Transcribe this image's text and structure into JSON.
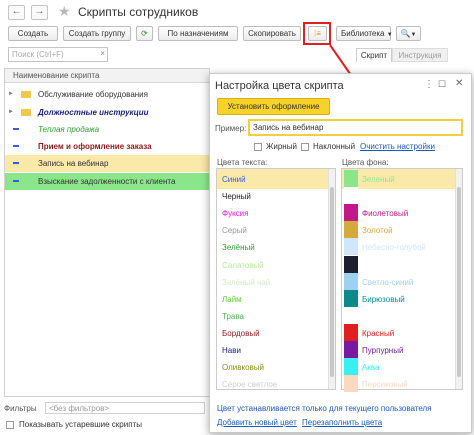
{
  "window": {
    "title": "Скрипты сотрудников"
  },
  "toolbar": {
    "create": "Создать",
    "create_group": "Создать группу",
    "by_assignments": "По назначениям",
    "copy": "Скопировать",
    "library": "Библиотека"
  },
  "search": {
    "placeholder": "Поиск (Ctrl+F)"
  },
  "table": {
    "header": "Наименование скрипта",
    "rows": [
      {
        "label": "Обслуживание оборудования"
      },
      {
        "label": "Должностные инструкции"
      },
      {
        "label": "Теплая продажа"
      },
      {
        "label": "Прием и оформление заказа"
      },
      {
        "label": "Запись на вебинар"
      },
      {
        "label": "Взыскание задолженности с клиента"
      }
    ]
  },
  "right_tabs": {
    "script": "Скрипт",
    "instruction": "Инструкция"
  },
  "footer": {
    "filters_label": "Фильтры",
    "filters_value": "<без фильтров>",
    "show_old": "Показывать устаревшие скрипты"
  },
  "dialog": {
    "title": "Настройка цвета скрипта",
    "apply_button": "Установить оформление",
    "example_label": "Пример:",
    "example_value": "Запись на вебинар",
    "bold_label": "Жирный",
    "italic_label": "Наклонный",
    "clear_link": "Очистить настройки",
    "text_colors_label": "Цвета текста:",
    "bg_colors_label": "Цвета фона:",
    "text_colors": [
      {
        "name": "Синий",
        "color": "#3b5bd8"
      },
      {
        "name": "Черный",
        "color": "#222222"
      },
      {
        "name": "Фуксия",
        "color": "#e020e0"
      },
      {
        "name": "Серый",
        "color": "#999999"
      },
      {
        "name": "Зелёный",
        "color": "#2f9e2f"
      },
      {
        "name": "Салатовый",
        "color": "#b4e89a"
      },
      {
        "name": "Зелёный чай",
        "color": "#d3ecc6"
      },
      {
        "name": "Лайм",
        "color": "#66cc33"
      },
      {
        "name": "Трава",
        "color": "#52b452"
      },
      {
        "name": "Бордовый",
        "color": "#8b1a1a"
      },
      {
        "name": "Нави",
        "color": "#1a237e"
      },
      {
        "name": "Оливковый",
        "color": "#8a8a1a"
      },
      {
        "name": "Серое светлое",
        "color": "#cfcfcf"
      }
    ],
    "bg_colors": [
      {
        "name": "Зеленый",
        "color": "#8be68b"
      },
      {
        "name": "",
        "color": "#ffffff"
      },
      {
        "name": "Фиолетовый",
        "color": "#c2188a"
      },
      {
        "name": "Золотой",
        "color": "#d4aa3c"
      },
      {
        "name": "Небесно-голубой",
        "color": "#cfe6fb"
      },
      {
        "name": "",
        "color": "#1f1f2f"
      },
      {
        "name": "Светло-синий",
        "color": "#9fd0f0"
      },
      {
        "name": "Бирюзовый",
        "color": "#0a8a8a"
      },
      {
        "name": "",
        "color": "#ffffff"
      },
      {
        "name": "Красный",
        "color": "#e02020"
      },
      {
        "name": "Пурпурный",
        "color": "#7a1aa0"
      },
      {
        "name": "Аква",
        "color": "#38f0f0"
      },
      {
        "name": "Персиковый",
        "color": "#fbd8c0"
      }
    ],
    "note": "Цвет устанавливается только для текущего пользователя",
    "add_color_link": "Добавить новый цвет",
    "refill_link": "Перезаполнить цвета"
  }
}
